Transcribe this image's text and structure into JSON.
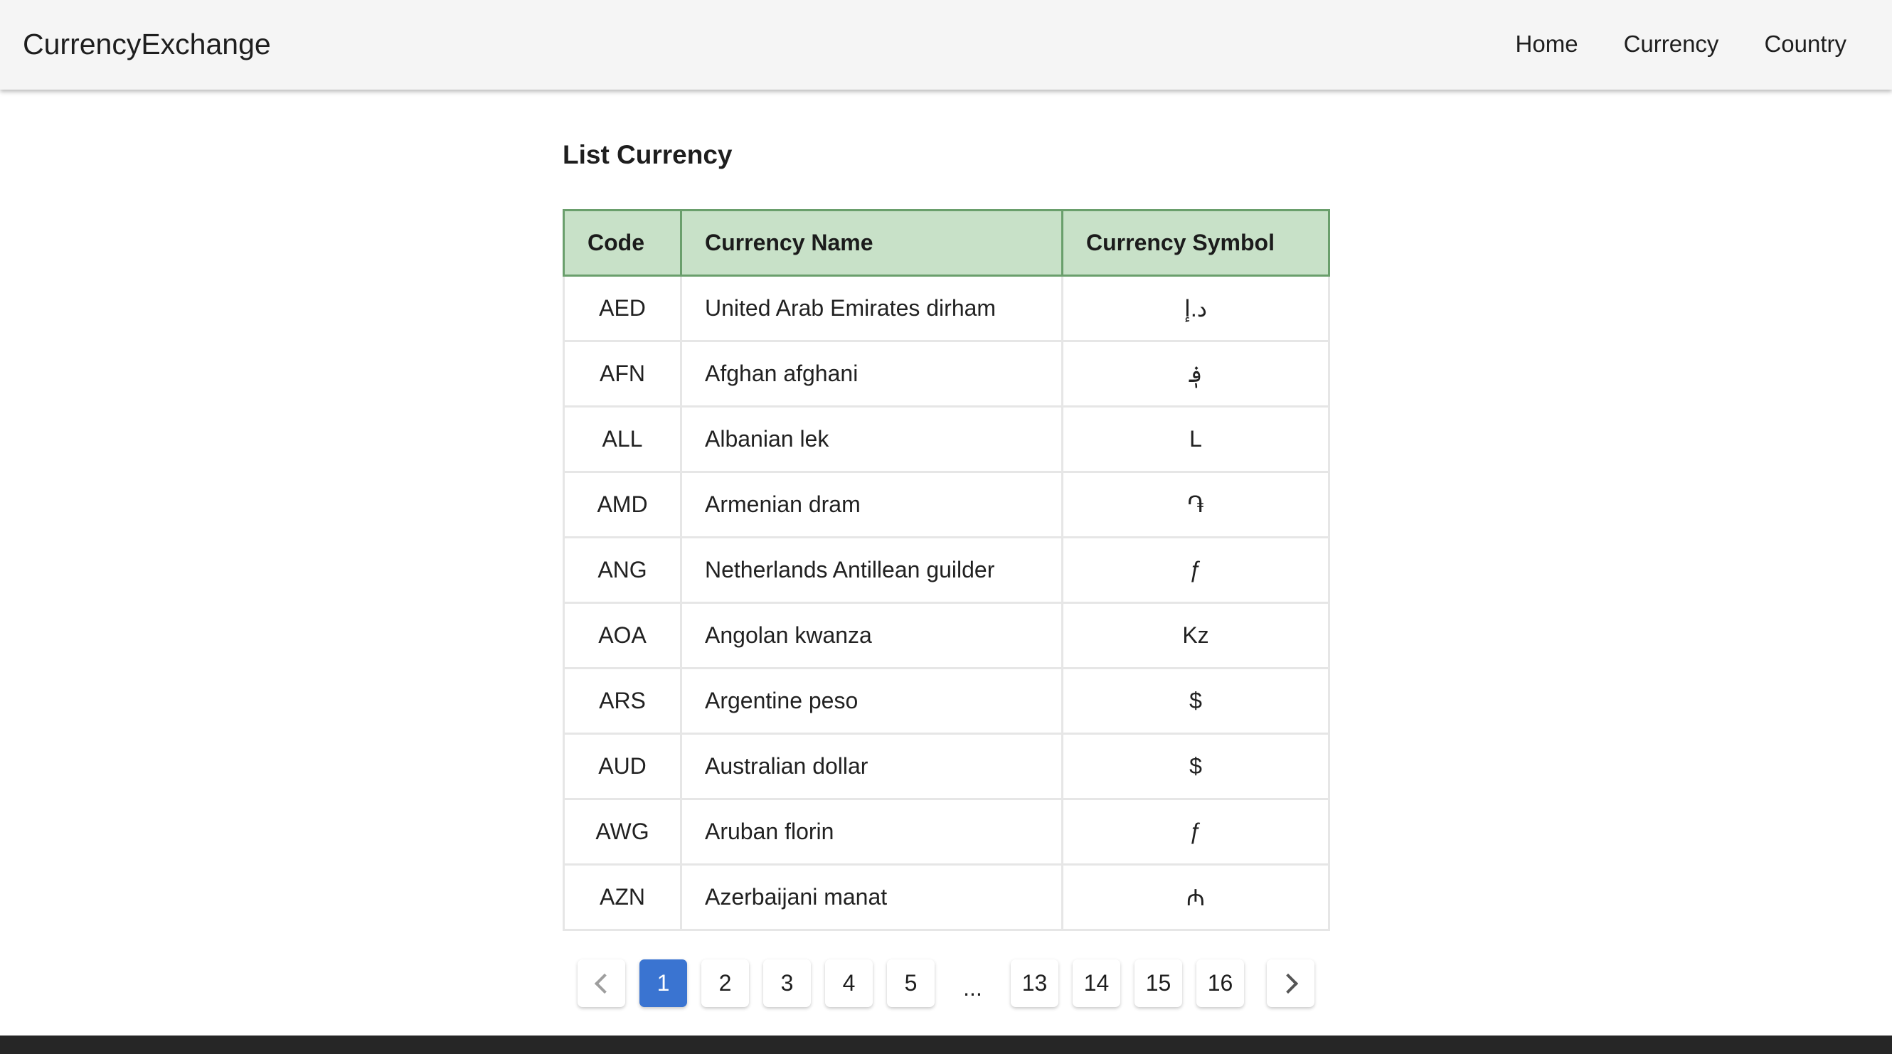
{
  "navbar": {
    "brand": "CurrencyExchange",
    "links": [
      "Home",
      "Currency",
      "Country"
    ]
  },
  "page": {
    "title": "List Currency"
  },
  "table": {
    "headers": [
      "Code",
      "Currency Name",
      "Currency Symbol"
    ],
    "rows": [
      [
        "AED",
        "United Arab Emirates dirham",
        "د.إ"
      ],
      [
        "AFN",
        "Afghan afghani",
        "؋"
      ],
      [
        "ALL",
        "Albanian lek",
        "L"
      ],
      [
        "AMD",
        "Armenian dram",
        "֏"
      ],
      [
        "ANG",
        "Netherlands Antillean guilder",
        "ƒ"
      ],
      [
        "AOA",
        "Angolan kwanza",
        "Kz"
      ],
      [
        "ARS",
        "Argentine peso",
        "$"
      ],
      [
        "AUD",
        "Australian dollar",
        "$"
      ],
      [
        "AWG",
        "Aruban florin",
        "ƒ"
      ],
      [
        "AZN",
        "Azerbaijani manat",
        "₼"
      ]
    ]
  },
  "pagination": {
    "current": "1",
    "pages_start": [
      "1",
      "2",
      "3",
      "4",
      "5"
    ],
    "ellipsis": "...",
    "pages_end": [
      "13",
      "14",
      "15",
      "16"
    ],
    "prev_icon": "chevron-left-icon",
    "next_icon": "chevron-right-icon"
  },
  "colors": {
    "header_bg": "#c8e1c8",
    "header_border": "#6a9f6c",
    "active_page": "#3a74d1",
    "navbar_bg": "#f5f5f5"
  }
}
